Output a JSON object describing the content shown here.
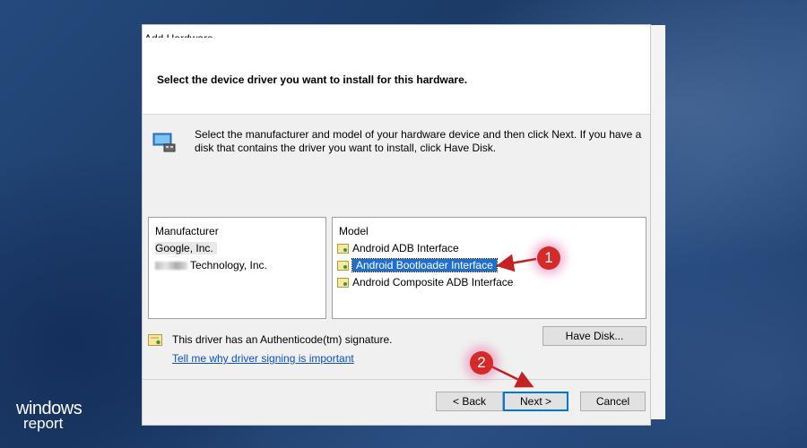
{
  "window": {
    "title": "Add Hardware"
  },
  "header": {
    "title": "Select the device driver you want to install for this hardware."
  },
  "intro_text": "Select the manufacturer and model of your hardware device and then click Next. If you have a disk that contains the driver you want to install, click Have Disk.",
  "manufacturer": {
    "header": "Manufacturer",
    "items": [
      {
        "label": "Google, Inc."
      },
      {
        "label": "Technology, Inc."
      }
    ]
  },
  "model": {
    "header": "Model",
    "items": [
      {
        "label": "Android ADB Interface"
      },
      {
        "label": "Android Bootloader Interface"
      },
      {
        "label": "Android Composite ADB Interface"
      }
    ]
  },
  "signature": {
    "text": "This driver has an Authenticode(tm) signature.",
    "link": "Tell me why driver signing is important"
  },
  "buttons": {
    "have_disk": "Have Disk...",
    "back": "< Back",
    "next": "Next >",
    "cancel": "Cancel"
  },
  "annotations": {
    "step1": "1",
    "step2": "2"
  },
  "watermark": {
    "line1": "windows",
    "line2": "report"
  },
  "colors": {
    "selection": "#1e6fd0",
    "annotation": "#d42a2a",
    "link": "#0a4fc7",
    "desktop": "#1f4373"
  }
}
